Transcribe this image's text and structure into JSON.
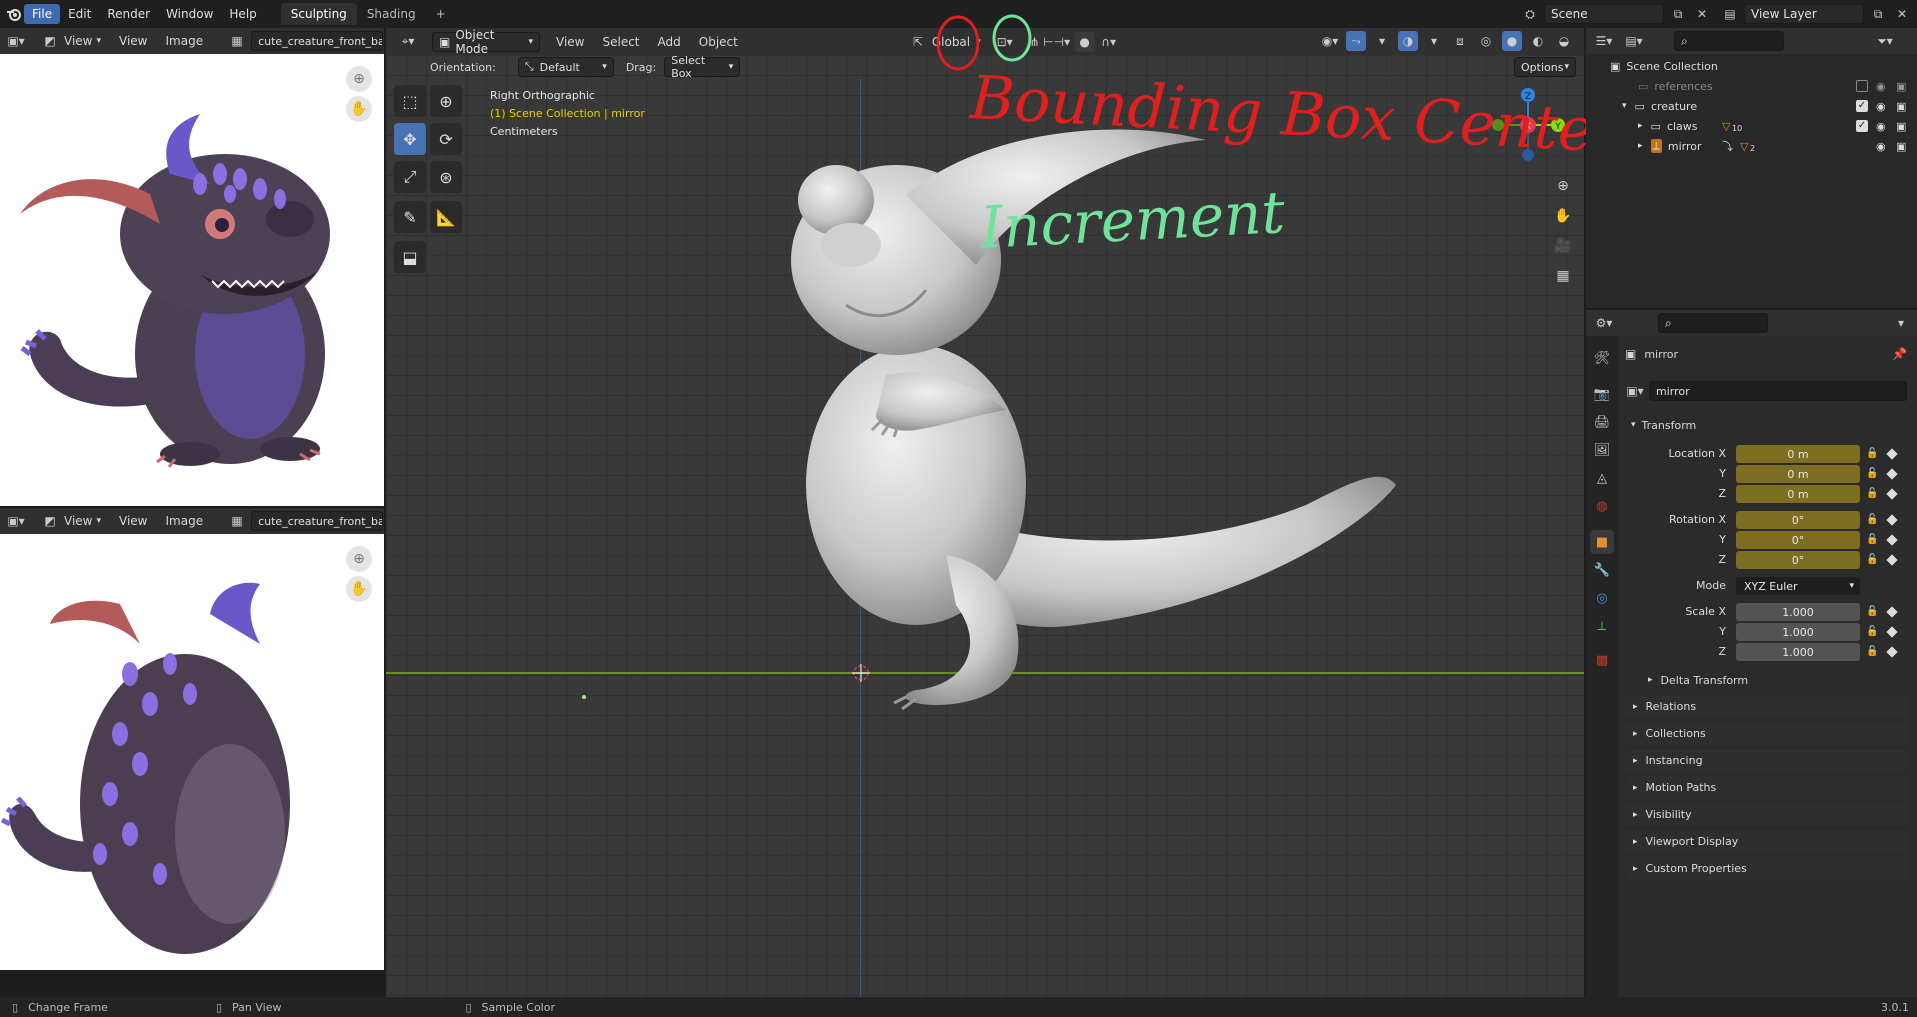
{
  "topbar": {
    "menu": [
      "File",
      "Edit",
      "Render",
      "Window",
      "Help"
    ],
    "workspaces": [
      "Sculpting",
      "Shading"
    ],
    "add_tab": "+",
    "scene_label": "Scene",
    "view_layer_label": "View Layer"
  },
  "image_editor_top": {
    "view_menu": "View",
    "view_label": "View",
    "image_menu": "Image",
    "image_name": "cute_creature_front_back."
  },
  "image_editor_bottom": {
    "view_menu": "View",
    "view_label": "View",
    "image_menu": "Image",
    "image_name": "cute_creature_front_back."
  },
  "viewport_header": {
    "mode": "Object Mode",
    "menus": [
      "View",
      "Select",
      "Add",
      "Object"
    ],
    "transform_orientation": "Global",
    "orientation_label": "Orientation:",
    "orientation_value": "Default",
    "drag_label": "Drag:",
    "drag_value": "Select Box",
    "options_label": "Options"
  },
  "viewport_overlay": {
    "view_name": "Right Orthographic",
    "collection_info": "(1) Scene Collection | mirror",
    "units": "Centimeters"
  },
  "annotations": {
    "red_text": "Bounding Box Center",
    "green_text": "Increment",
    "red_color": "#e0201e",
    "green_color": "#6fe39a"
  },
  "gizmo": {
    "z": "Z",
    "y": "Y",
    "x": "X"
  },
  "outliner": {
    "root": "Scene Collection",
    "items": [
      {
        "label": "references"
      },
      {
        "label": "creature"
      },
      {
        "label": "claws",
        "badge": "10"
      },
      {
        "label": "mirror",
        "badge": "2"
      }
    ]
  },
  "properties": {
    "object_name": "mirror",
    "data_name": "mirror",
    "transform_header": "Transform",
    "location": {
      "label_x": "Location X",
      "label_y": "Y",
      "label_z": "Z",
      "x": "0 m",
      "y": "0 m",
      "z": "0 m"
    },
    "rotation": {
      "label_x": "Rotation X",
      "label_y": "Y",
      "label_z": "Z",
      "x": "0°",
      "y": "0°",
      "z": "0°"
    },
    "mode_label": "Mode",
    "mode_value": "XYZ Euler",
    "scale": {
      "label_x": "Scale X",
      "label_y": "Y",
      "label_z": "Z",
      "x": "1.000",
      "y": "1.000",
      "z": "1.000"
    },
    "delta_transform": "Delta Transform",
    "subpanels": [
      "Relations",
      "Collections",
      "Instancing",
      "Motion Paths",
      "Visibility",
      "Viewport Display",
      "Custom Properties"
    ]
  },
  "statusbar": {
    "items": [
      "Change Frame",
      "Pan View",
      "Sample Color"
    ],
    "version": "3.0.1"
  },
  "colors": {
    "accent": "#4772b3",
    "keyed_field": "#7e6e22",
    "axis_x": "#e8384f",
    "axis_y": "#8bdc00",
    "axis_z": "#2f83e4"
  }
}
